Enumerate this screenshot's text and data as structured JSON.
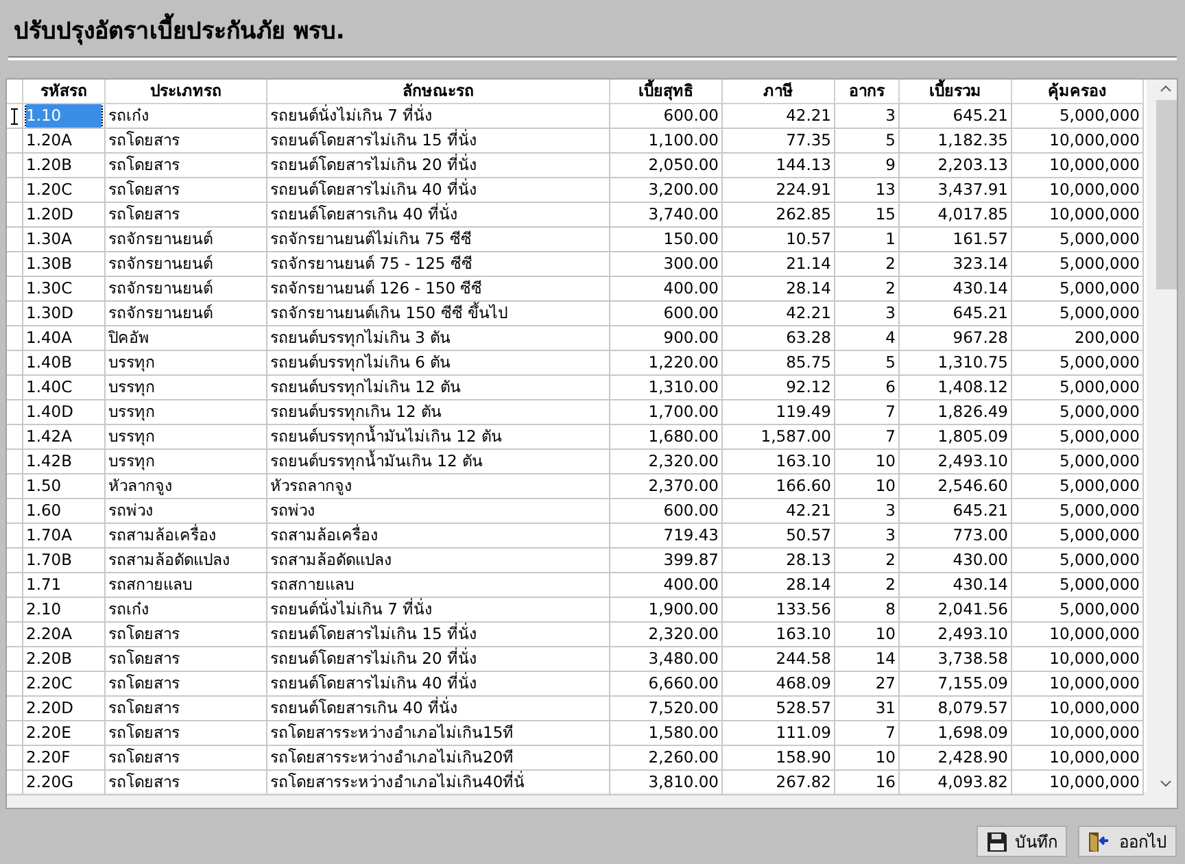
{
  "window": {
    "title": "ปรับปรุงอัตราเบี้ยประกันภัย พรบ."
  },
  "table": {
    "columns": [
      {
        "label": "รหัสรถ",
        "kind": "text"
      },
      {
        "label": "ประเภทรถ",
        "kind": "text"
      },
      {
        "label": "ลักษณะรถ",
        "kind": "text"
      },
      {
        "label": "เบี้ยสุทธิ",
        "kind": "number"
      },
      {
        "label": "ภาษี",
        "kind": "number"
      },
      {
        "label": "อากร",
        "kind": "number"
      },
      {
        "label": "เบี้ยรวม",
        "kind": "number"
      },
      {
        "label": "คุ้มครอง",
        "kind": "number"
      }
    ],
    "rows": [
      {
        "selected": true,
        "cells": [
          "1.10",
          "รถเก๋ง",
          "รถยนต์นั่งไม่เกิน 7 ที่นั่ง",
          "600.00",
          "42.21",
          "3",
          "645.21",
          "5,000,000"
        ]
      },
      {
        "selected": false,
        "cells": [
          "1.20A",
          "รถโดยสาร",
          "รถยนต์โดยสารไม่เกิน 15 ที่นั่ง",
          "1,100.00",
          "77.35",
          "5",
          "1,182.35",
          "10,000,000"
        ]
      },
      {
        "selected": false,
        "cells": [
          "1.20B",
          "รถโดยสาร",
          "รถยนต์โดยสารไม่เกิน 20 ที่นั่ง",
          "2,050.00",
          "144.13",
          "9",
          "2,203.13",
          "10,000,000"
        ]
      },
      {
        "selected": false,
        "cells": [
          "1.20C",
          "รถโดยสาร",
          "รถยนต์โดยสารไม่เกิน 40 ที่นั่ง",
          "3,200.00",
          "224.91",
          "13",
          "3,437.91",
          "10,000,000"
        ]
      },
      {
        "selected": false,
        "cells": [
          "1.20D",
          "รถโดยสาร",
          "รถยนต์โดยสารเกิน 40 ที่นั่ง",
          "3,740.00",
          "262.85",
          "15",
          "4,017.85",
          "10,000,000"
        ]
      },
      {
        "selected": false,
        "cells": [
          "1.30A",
          "รถจักรยานยนต์",
          "รถจักรยานยนต์ไม่เกิน 75 ซีซี",
          "150.00",
          "10.57",
          "1",
          "161.57",
          "5,000,000"
        ]
      },
      {
        "selected": false,
        "cells": [
          "1.30B",
          "รถจักรยานยนต์",
          "รถจักรยานยนต์ 75 - 125 ซีซี",
          "300.00",
          "21.14",
          "2",
          "323.14",
          "5,000,000"
        ]
      },
      {
        "selected": false,
        "cells": [
          "1.30C",
          "รถจักรยานยนต์",
          "รถจักรยานยนต์ 126 - 150 ซีซี",
          "400.00",
          "28.14",
          "2",
          "430.14",
          "5,000,000"
        ]
      },
      {
        "selected": false,
        "cells": [
          "1.30D",
          "รถจักรยานยนต์",
          "รถจักรยานยนต์เกิน 150 ซีซี ขึ้นไป",
          "600.00",
          "42.21",
          "3",
          "645.21",
          "5,000,000"
        ]
      },
      {
        "selected": false,
        "cells": [
          "1.40A",
          "ปิคอัพ",
          "รถยนต์บรรทุกไม่เกิน 3 ตัน",
          "900.00",
          "63.28",
          "4",
          "967.28",
          "200,000"
        ]
      },
      {
        "selected": false,
        "cells": [
          "1.40B",
          "บรรทุก",
          "รถยนต์บรรทุกไม่เกิน 6 ตัน",
          "1,220.00",
          "85.75",
          "5",
          "1,310.75",
          "5,000,000"
        ]
      },
      {
        "selected": false,
        "cells": [
          "1.40C",
          "บรรทุก",
          "รถยนต์บรรทุกไม่เกิน 12 ตัน",
          "1,310.00",
          "92.12",
          "6",
          "1,408.12",
          "5,000,000"
        ]
      },
      {
        "selected": false,
        "cells": [
          "1.40D",
          "บรรทุก",
          "รถยนต์บรรทุกเกิน 12 ตัน",
          "1,700.00",
          "119.49",
          "7",
          "1,826.49",
          "5,000,000"
        ]
      },
      {
        "selected": false,
        "cells": [
          "1.42A",
          "บรรทุก",
          "รถยนต์บรรทุกน้ำมันไม่เกิน 12 ตัน",
          "1,680.00",
          "1,587.00",
          "7",
          "1,805.09",
          "5,000,000"
        ]
      },
      {
        "selected": false,
        "cells": [
          "1.42B",
          "บรรทุก",
          "รถยนต์บรรทุกน้ำมันเกิน 12 ตัน",
          "2,320.00",
          "163.10",
          "10",
          "2,493.10",
          "5,000,000"
        ]
      },
      {
        "selected": false,
        "cells": [
          "1.50",
          "หัวลากจูง",
          "หัวรถลากจูง",
          "2,370.00",
          "166.60",
          "10",
          "2,546.60",
          "5,000,000"
        ]
      },
      {
        "selected": false,
        "cells": [
          "1.60",
          "รถพ่วง",
          "รถพ่วง",
          "600.00",
          "42.21",
          "3",
          "645.21",
          "5,000,000"
        ]
      },
      {
        "selected": false,
        "cells": [
          "1.70A",
          "รถสามล้อเครื่อง",
          "รถสามล้อเครื่อง",
          "719.43",
          "50.57",
          "3",
          "773.00",
          "5,000,000"
        ]
      },
      {
        "selected": false,
        "cells": [
          "1.70B",
          "รถสามล้อดัดแปลง",
          "รถสามล้อดัดแปลง",
          "399.87",
          "28.13",
          "2",
          "430.00",
          "5,000,000"
        ]
      },
      {
        "selected": false,
        "cells": [
          "1.71",
          "รถสกายแลบ",
          "รถสกายแลบ",
          "400.00",
          "28.14",
          "2",
          "430.14",
          "5,000,000"
        ]
      },
      {
        "selected": false,
        "cells": [
          "2.10",
          "รถเก๋ง",
          "รถยนต์นั่งไม่เกิน 7 ที่นั่ง",
          "1,900.00",
          "133.56",
          "8",
          "2,041.56",
          "5,000,000"
        ]
      },
      {
        "selected": false,
        "cells": [
          "2.20A",
          "รถโดยสาร",
          "รถยนต์โดยสารไม่เกิน 15 ที่นั่ง",
          "2,320.00",
          "163.10",
          "10",
          "2,493.10",
          "10,000,000"
        ]
      },
      {
        "selected": false,
        "cells": [
          "2.20B",
          "รถโดยสาร",
          "รถยนต์โดยสารไม่เกิน 20 ที่นั่ง",
          "3,480.00",
          "244.58",
          "14",
          "3,738.58",
          "10,000,000"
        ]
      },
      {
        "selected": false,
        "cells": [
          "2.20C",
          "รถโดยสาร",
          "รถยนต์โดยสารไม่เกิน 40 ที่นั่ง",
          "6,660.00",
          "468.09",
          "27",
          "7,155.09",
          "10,000,000"
        ]
      },
      {
        "selected": false,
        "cells": [
          "2.20D",
          "รถโดยสาร",
          "รถยนต์โดยสารเกิน 40 ที่นั่ง",
          "7,520.00",
          "528.57",
          "31",
          "8,079.57",
          "10,000,000"
        ]
      },
      {
        "selected": false,
        "cells": [
          "2.20E",
          "รถโดยสาร",
          "รถโดยสารระหว่างอำเภอไม่เกิน15ที",
          "1,580.00",
          "111.09",
          "7",
          "1,698.09",
          "10,000,000"
        ]
      },
      {
        "selected": false,
        "cells": [
          "2.20F",
          "รถโดยสาร",
          "รถโดยสารระหว่างอำเภอไม่เกิน20ที",
          "2,260.00",
          "158.90",
          "10",
          "2,428.90",
          "10,000,000"
        ]
      },
      {
        "selected": false,
        "cells": [
          "2.20G",
          "รถโดยสาร",
          "รถโดยสารระหว่างอำเภอไม่เกิน40ที่นั่",
          "3,810.00",
          "267.82",
          "16",
          "4,093.82",
          "10,000,000"
        ]
      }
    ]
  },
  "buttons": [
    {
      "label": "บันทึก",
      "kind": "save"
    },
    {
      "label": "ออกไป",
      "kind": "exit"
    }
  ]
}
